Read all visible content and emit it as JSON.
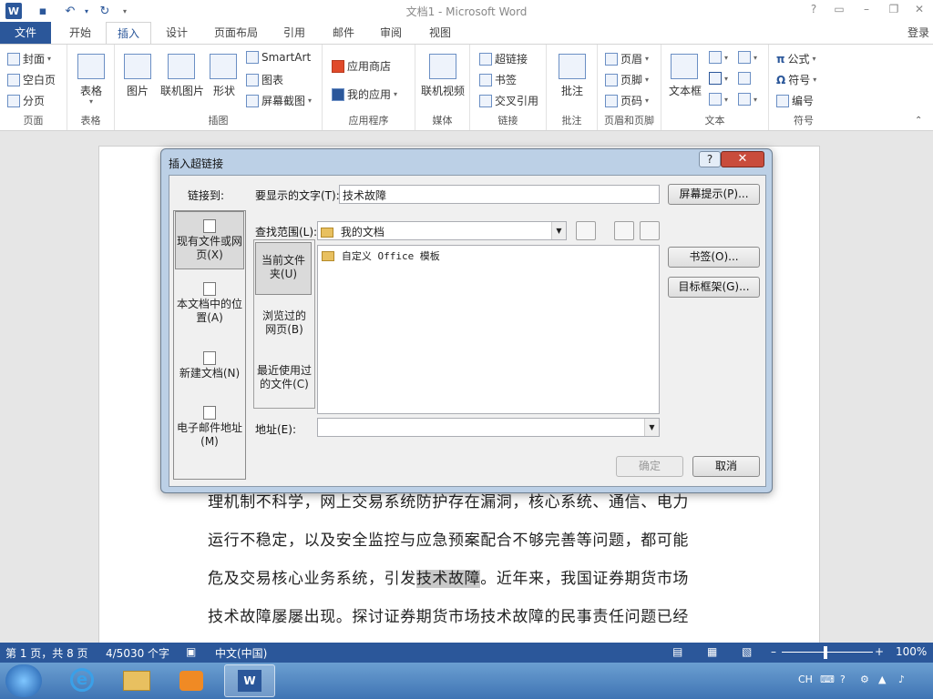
{
  "window": {
    "title": "文档1 - Microsoft Word",
    "help": "?"
  },
  "tabs": {
    "file": "文件",
    "home": "开始",
    "insert": "插入",
    "design": "设计",
    "layout": "页面布局",
    "references": "引用",
    "mailings": "邮件",
    "review": "审阅",
    "view": "视图",
    "login": "登录"
  },
  "ribbon": {
    "pages": {
      "cover": "封面",
      "blank": "空白页",
      "break": "分页",
      "label": "页面"
    },
    "tables": {
      "table": "表格",
      "label": "表格"
    },
    "illustrations": {
      "picture": "图片",
      "online_picture": "联机图片",
      "shapes": "形状",
      "smartart": "SmartArt",
      "chart": "图表",
      "screenshot": "屏幕截图",
      "label": "插图"
    },
    "apps": {
      "store": "应用商店",
      "myapps": "我的应用",
      "label": "应用程序"
    },
    "media": {
      "online_video": "联机视频",
      "label": "媒体"
    },
    "links": {
      "hyperlink": "超链接",
      "bookmark": "书签",
      "crossref": "交叉引用",
      "label": "链接"
    },
    "comments": {
      "comment": "批注",
      "label": "批注"
    },
    "headerfooter": {
      "header": "页眉",
      "footer": "页脚",
      "pagenum": "页码",
      "label": "页眉和页脚"
    },
    "text": {
      "textbox": "文本框",
      "label": "文本"
    },
    "symbols": {
      "equation": "公式",
      "symbol": "符号",
      "number": "编号",
      "label": "符号"
    }
  },
  "dialog": {
    "title": "插入超链接",
    "link_to": "链接到:",
    "display_text_label": "要显示的文字(T):",
    "display_text_value": "技术故障",
    "screentip": "屏幕提示(P)...",
    "look_in_label": "查找范围(L):",
    "look_in_value": "我的文档",
    "bookmark": "书签(O)...",
    "target_frame": "目标框架(G)...",
    "address_label": "地址(E):",
    "address_value": "",
    "ok": "确定",
    "cancel": "取消",
    "link_options": [
      {
        "line1": "现有文件或网",
        "line2": "页(X)"
      },
      {
        "line1": "本文档中的位",
        "line2": "置(A)"
      },
      {
        "line1": "新建文档(N)",
        "line2": ""
      },
      {
        "line1": "电子邮件地址",
        "line2": "(M)"
      }
    ],
    "subnav": [
      {
        "line1": "当前文件",
        "line2": "夹(U)"
      },
      {
        "line1": "浏览过的",
        "line2": "网页(B)"
      },
      {
        "line1": "最近使用过",
        "line2": "的文件(C)"
      }
    ],
    "files": [
      "自定义 Office 模板"
    ]
  },
  "document": {
    "lines": [
      "理机制不科学，网上交易系统防护存在漏洞，核心系统、通信、电力",
      "运行不稳定，以及安全监控与应急预案配合不够完善等问题，都可能",
      "危及交易核心业务系统，引发技术故障。近年来，我国证券期货市场",
      "技术故障屡屡出现。探讨证券期货市场技术故障的民事责任问题已经"
    ],
    "line3_before": "危及交易核心业务系统，引发",
    "line3_highlight": "技术故障",
    "line3_after": "。近年来，我国证券期货市场"
  },
  "status": {
    "page": "第 1 页，共 8 页",
    "words": "4/5030 个字",
    "lang": "中文(中国)",
    "zoom": "100%"
  },
  "tray": {
    "ime": "CH"
  }
}
